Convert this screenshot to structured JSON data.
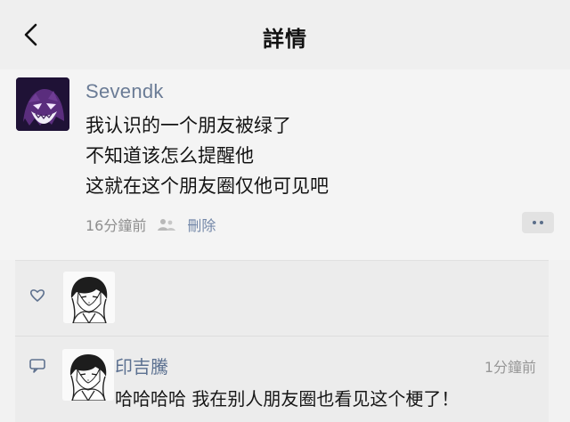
{
  "header": {
    "title": "詳情",
    "back_icon": "chevron-left-icon"
  },
  "post": {
    "username": "Sevendk",
    "lines": [
      "我认识的一个朋友被绿了",
      "不知道该怎么提醒他",
      "这就在这个朋友圈仅他可见吧"
    ],
    "time": "16分鐘前",
    "privacy_icon": "privacy-icon",
    "delete_label": "刪除",
    "more_icon": "more-dots-icon"
  },
  "interactions": {
    "like_icon": "heart-icon",
    "comment_icon": "comment-icon",
    "comment": {
      "author": "印吉騰",
      "time": "1分鐘前",
      "text": "哈哈哈哈 我在别人朋友圈也看见这个梗了！"
    }
  },
  "colors": {
    "link_blue": "#6b7c96",
    "text_dark": "#141414",
    "muted_gray": "#9a9a9a",
    "panel_gray": "#ececec"
  }
}
